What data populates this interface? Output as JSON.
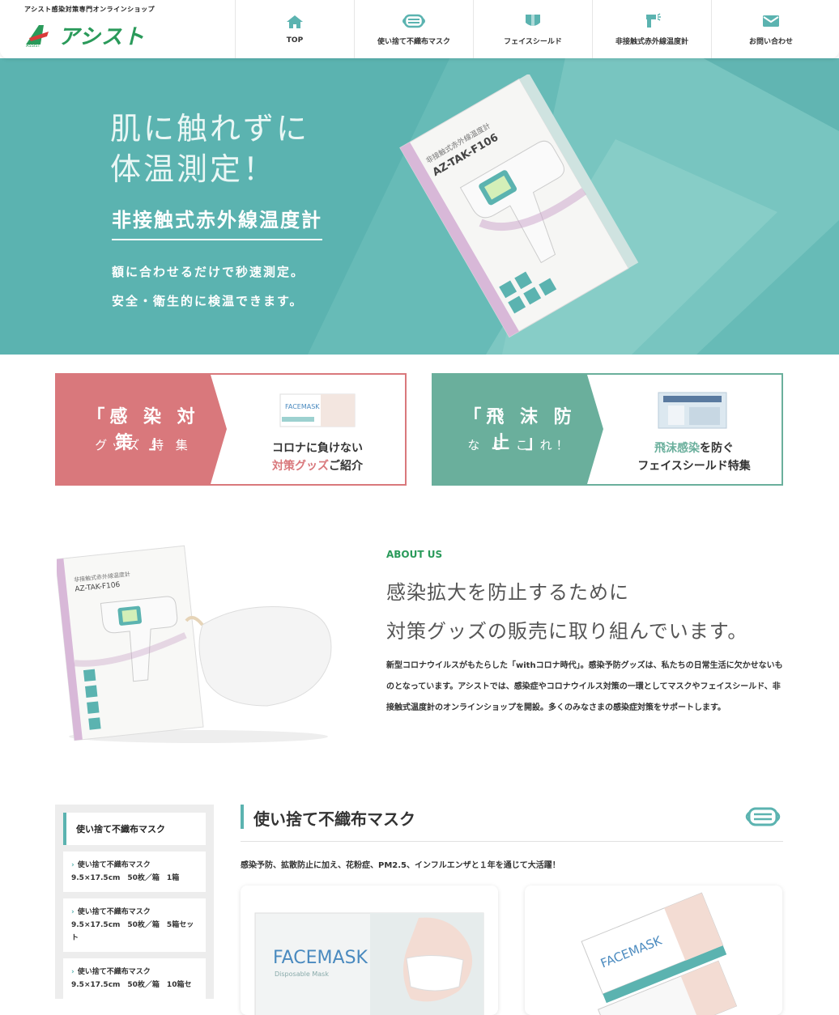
{
  "header": {
    "tagline": "アシスト感染対策専門オンラインショップ",
    "logo_text": "アシスト",
    "nav": [
      {
        "label": "TOP",
        "icon": "home-icon"
      },
      {
        "label": "使い捨て不織布マスク",
        "icon": "mask-icon"
      },
      {
        "label": "フェイスシールド",
        "icon": "face-shield-icon"
      },
      {
        "label": "非接触式赤外線温度計",
        "icon": "thermometer-icon"
      },
      {
        "label": "お問い合わせ",
        "icon": "mail-icon"
      }
    ]
  },
  "hero": {
    "line1": "肌に触れずに",
    "line2": "体温測定！",
    "subtitle": "非接触式赤外線温度計",
    "desc1": "額に合わせるだけで秒速測定。",
    "desc2": "安全・衛生的に検温できます。",
    "product_code": "AZ-TAK-F106",
    "product_label": "非接触式赤外線温度計"
  },
  "banners": [
    {
      "title": "「感 染 対 策 」",
      "sub": "グッズ 特 集",
      "text1": "コロナに負けない",
      "text2_accent": "対策グッズ",
      "text2_rest": "ご紹介",
      "accent_color": "#d9787c"
    },
    {
      "title": "「飛 沫 防 止 」",
      "sub": "な ら こ れ！",
      "text1_accent": "飛沫感染",
      "text1_rest": "を防ぐ",
      "text2": "フェイスシールド特集",
      "accent_color": "#6aaf9c"
    }
  ],
  "about": {
    "label": "ABOUT US",
    "title1": "感染拡大を防止するために",
    "title2": "対策グッズの販売に取り組んでいます。",
    "text": "新型コロナウイルスがもたらした「withコロナ時代」。感染予防グッズは、私たちの日常生活に欠かせないものとなっています。アシストでは、感染症やコロナウイルス対策の一環としてマスクやフェイスシールド、非接触式温度計のオンラインショップを開設。多くのみなさまの感染症対策をサポートします。",
    "image_code": "AZ-TAK-F106"
  },
  "sidebar": {
    "title": "使い捨て不織布マスク",
    "items": [
      {
        "line1": "使い捨て不織布マスク",
        "line2": "9.5×17.5cm　50枚／箱　1箱"
      },
      {
        "line1": "使い捨て不織布マスク",
        "line2": "9.5×17.5cm　50枚／箱　5箱セット"
      },
      {
        "line1": "使い捨て不織布マスク",
        "line2": "9.5×17.5cm　50枚／箱　10箱セ"
      }
    ]
  },
  "section": {
    "title": "使い捨て不織布マスク",
    "icon": "mask-icon",
    "desc": "感染予防、拡散防止に加え、花粉症、PM2.5、インフルエンザと１年を通じて大活躍！",
    "products": [
      {
        "brand": "FACEMASK",
        "sub": "Disposable Mask"
      },
      {
        "brand": "FACEMASK"
      }
    ]
  },
  "colors": {
    "teal": "#5bb3b0",
    "green": "#2a9a5a",
    "pink": "#d9787c",
    "mint": "#6aaf9c"
  }
}
